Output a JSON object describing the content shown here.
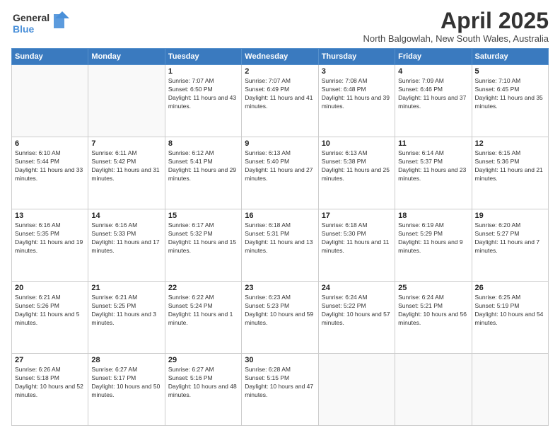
{
  "header": {
    "logo_line1": "General",
    "logo_line2": "Blue",
    "month": "April 2025",
    "location": "North Balgowlah, New South Wales, Australia"
  },
  "weekdays": [
    "Sunday",
    "Monday",
    "Tuesday",
    "Wednesday",
    "Thursday",
    "Friday",
    "Saturday"
  ],
  "weeks": [
    [
      {
        "day": "",
        "info": ""
      },
      {
        "day": "",
        "info": ""
      },
      {
        "day": "1",
        "info": "Sunrise: 7:07 AM\nSunset: 6:50 PM\nDaylight: 11 hours and 43 minutes."
      },
      {
        "day": "2",
        "info": "Sunrise: 7:07 AM\nSunset: 6:49 PM\nDaylight: 11 hours and 41 minutes."
      },
      {
        "day": "3",
        "info": "Sunrise: 7:08 AM\nSunset: 6:48 PM\nDaylight: 11 hours and 39 minutes."
      },
      {
        "day": "4",
        "info": "Sunrise: 7:09 AM\nSunset: 6:46 PM\nDaylight: 11 hours and 37 minutes."
      },
      {
        "day": "5",
        "info": "Sunrise: 7:10 AM\nSunset: 6:45 PM\nDaylight: 11 hours and 35 minutes."
      }
    ],
    [
      {
        "day": "6",
        "info": "Sunrise: 6:10 AM\nSunset: 5:44 PM\nDaylight: 11 hours and 33 minutes."
      },
      {
        "day": "7",
        "info": "Sunrise: 6:11 AM\nSunset: 5:42 PM\nDaylight: 11 hours and 31 minutes."
      },
      {
        "day": "8",
        "info": "Sunrise: 6:12 AM\nSunset: 5:41 PM\nDaylight: 11 hours and 29 minutes."
      },
      {
        "day": "9",
        "info": "Sunrise: 6:13 AM\nSunset: 5:40 PM\nDaylight: 11 hours and 27 minutes."
      },
      {
        "day": "10",
        "info": "Sunrise: 6:13 AM\nSunset: 5:38 PM\nDaylight: 11 hours and 25 minutes."
      },
      {
        "day": "11",
        "info": "Sunrise: 6:14 AM\nSunset: 5:37 PM\nDaylight: 11 hours and 23 minutes."
      },
      {
        "day": "12",
        "info": "Sunrise: 6:15 AM\nSunset: 5:36 PM\nDaylight: 11 hours and 21 minutes."
      }
    ],
    [
      {
        "day": "13",
        "info": "Sunrise: 6:16 AM\nSunset: 5:35 PM\nDaylight: 11 hours and 19 minutes."
      },
      {
        "day": "14",
        "info": "Sunrise: 6:16 AM\nSunset: 5:33 PM\nDaylight: 11 hours and 17 minutes."
      },
      {
        "day": "15",
        "info": "Sunrise: 6:17 AM\nSunset: 5:32 PM\nDaylight: 11 hours and 15 minutes."
      },
      {
        "day": "16",
        "info": "Sunrise: 6:18 AM\nSunset: 5:31 PM\nDaylight: 11 hours and 13 minutes."
      },
      {
        "day": "17",
        "info": "Sunrise: 6:18 AM\nSunset: 5:30 PM\nDaylight: 11 hours and 11 minutes."
      },
      {
        "day": "18",
        "info": "Sunrise: 6:19 AM\nSunset: 5:29 PM\nDaylight: 11 hours and 9 minutes."
      },
      {
        "day": "19",
        "info": "Sunrise: 6:20 AM\nSunset: 5:27 PM\nDaylight: 11 hours and 7 minutes."
      }
    ],
    [
      {
        "day": "20",
        "info": "Sunrise: 6:21 AM\nSunset: 5:26 PM\nDaylight: 11 hours and 5 minutes."
      },
      {
        "day": "21",
        "info": "Sunrise: 6:21 AM\nSunset: 5:25 PM\nDaylight: 11 hours and 3 minutes."
      },
      {
        "day": "22",
        "info": "Sunrise: 6:22 AM\nSunset: 5:24 PM\nDaylight: 11 hours and 1 minute."
      },
      {
        "day": "23",
        "info": "Sunrise: 6:23 AM\nSunset: 5:23 PM\nDaylight: 10 hours and 59 minutes."
      },
      {
        "day": "24",
        "info": "Sunrise: 6:24 AM\nSunset: 5:22 PM\nDaylight: 10 hours and 57 minutes."
      },
      {
        "day": "25",
        "info": "Sunrise: 6:24 AM\nSunset: 5:21 PM\nDaylight: 10 hours and 56 minutes."
      },
      {
        "day": "26",
        "info": "Sunrise: 6:25 AM\nSunset: 5:19 PM\nDaylight: 10 hours and 54 minutes."
      }
    ],
    [
      {
        "day": "27",
        "info": "Sunrise: 6:26 AM\nSunset: 5:18 PM\nDaylight: 10 hours and 52 minutes."
      },
      {
        "day": "28",
        "info": "Sunrise: 6:27 AM\nSunset: 5:17 PM\nDaylight: 10 hours and 50 minutes."
      },
      {
        "day": "29",
        "info": "Sunrise: 6:27 AM\nSunset: 5:16 PM\nDaylight: 10 hours and 48 minutes."
      },
      {
        "day": "30",
        "info": "Sunrise: 6:28 AM\nSunset: 5:15 PM\nDaylight: 10 hours and 47 minutes."
      },
      {
        "day": "",
        "info": ""
      },
      {
        "day": "",
        "info": ""
      },
      {
        "day": "",
        "info": ""
      }
    ]
  ]
}
